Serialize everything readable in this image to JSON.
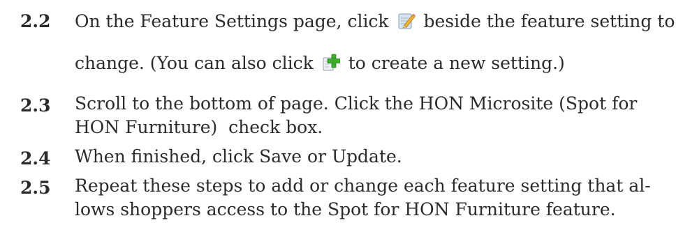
{
  "steps": [
    {
      "number": "2.2",
      "line1_before": "On the Feature Settings page, click",
      "line1_icon": "edit-pencil-icon",
      "line1_after": "beside the feature setting to",
      "line2_before": "change. (You can also click",
      "line2_icon": "add-new-green-plus-icon",
      "line2_after": "to create a new setting.)"
    },
    {
      "number": "2.3",
      "line1": "Scroll to the bottom of page. Click the HON Microsite (Spot for",
      "line2": "HON Furniture)  check box."
    },
    {
      "number": "2.4",
      "line1": "When finished, click Save or Update."
    },
    {
      "number": "2.5",
      "line1": "Repeat these steps to add or change each feature setting that al-",
      "line2": "lows shoppers access to the Spot for HON Furniture feature."
    }
  ],
  "colors": {
    "text": "#2b2b2b",
    "pencil_icon_pad": "#c9d6e6",
    "plus_icon_green": "#3fae2a"
  }
}
